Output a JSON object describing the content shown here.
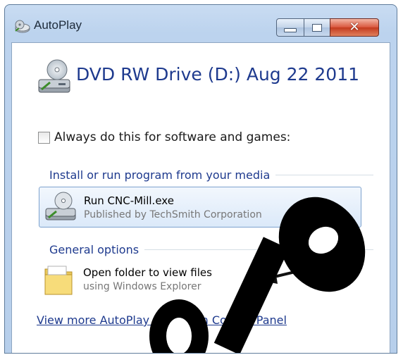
{
  "window": {
    "title": "AutoPlay",
    "controls": {
      "minimize": "minimize-icon",
      "maximize": "maximize-icon",
      "close": "close-icon"
    }
  },
  "drive": {
    "title": "DVD RW Drive (D:) Aug 22 2011",
    "icon": "dvd-drive-icon"
  },
  "always_checkbox": {
    "label": "Always do this for software and games:",
    "checked": false
  },
  "sections": {
    "install": "Install or run program from your media",
    "general": "General options"
  },
  "options": {
    "run": {
      "title": "Run CNC-Mill.exe",
      "subtitle": "Published by TechSmith Corporation",
      "icon": "dvd-drive-icon"
    },
    "open_folder": {
      "title": "Open folder to view files",
      "subtitle": "using Windows Explorer",
      "icon": "folder-icon"
    }
  },
  "footer_link": "View more AutoPlay options in Control Panel",
  "colors": {
    "link_blue": "#1e3a8e",
    "frame": "#bcd3ee",
    "close_red": "#c43a1e",
    "watermark": "#000000"
  }
}
